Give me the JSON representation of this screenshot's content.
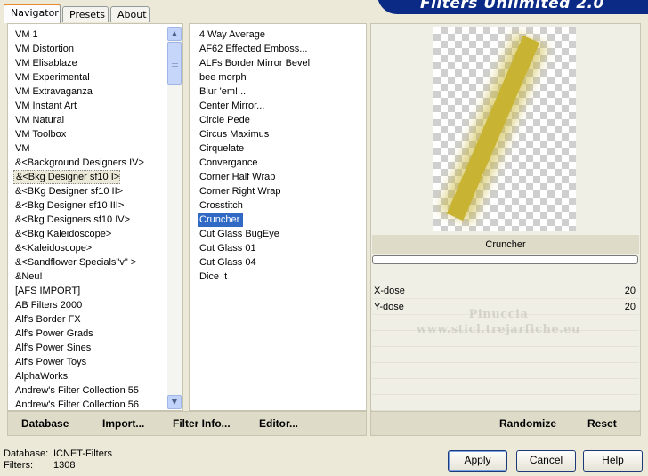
{
  "tabs": [
    "Navigator",
    "Presets",
    "About"
  ],
  "app_title": "Filters Unlimited 2.0",
  "categories": [
    "VM 1",
    "VM Distortion",
    "VM Elisablaze",
    "VM Experimental",
    "VM Extravaganza",
    "VM Instant Art",
    "VM Natural",
    "VM Toolbox",
    "VM",
    "&<Background Designers IV>",
    "&<Bkg Designer sf10 I>",
    "&<BKg Designer sf10 II>",
    "&<Bkg Designer sf10 III>",
    "&<Bkg Designers sf10 IV>",
    "&<Bkg Kaleidoscope>",
    "&<Kaleidoscope>",
    "&<Sandflower Specials\"v\" >",
    "&Neu!",
    "[AFS IMPORT]",
    "AB Filters 2000",
    "Alf's Border FX",
    "Alf's Power Grads",
    "Alf's Power Sines",
    "Alf's Power Toys",
    "AlphaWorks",
    "Andrew's Filter Collection 55",
    "Andrew's Filter Collection 56"
  ],
  "selected_category_index": 10,
  "filters": [
    "4 Way Average",
    "AF62 Effected Emboss...",
    "ALFs Border Mirror Bevel",
    "bee morph",
    "Blur 'em!...",
    "Center Mirror...",
    "Circle Pede",
    "Circus Maximus",
    "Cirquelate",
    "Convergance",
    "Corner Half Wrap",
    "Corner Right Wrap",
    "Crosstitch",
    "Cruncher",
    "Cut Glass  BugEye",
    "Cut Glass 01",
    "Cut Glass 04",
    "Dice It"
  ],
  "selected_filter_index": 13,
  "preview": {
    "filter_name": "Cruncher",
    "stroke_color": "#c8b432",
    "progress_fraction": 0.0
  },
  "params": [
    {
      "label": "X-dose",
      "value": "20"
    },
    {
      "label": "Y-dose",
      "value": "20"
    }
  ],
  "watermark": [
    "Pinuccia",
    "www.sticl.trejarfiche.eu"
  ],
  "left_buttons": [
    "Database",
    "Import...",
    "Filter Info...",
    "Editor..."
  ],
  "right_buttons": [
    "Randomize",
    "Reset"
  ],
  "status": {
    "database_label": "Database:",
    "database_value": "ICNET-Filters",
    "filters_label": "Filters:",
    "filters_value": "1308"
  },
  "dialog_buttons": {
    "apply": "Apply",
    "cancel": "Cancel",
    "help": "Help"
  }
}
